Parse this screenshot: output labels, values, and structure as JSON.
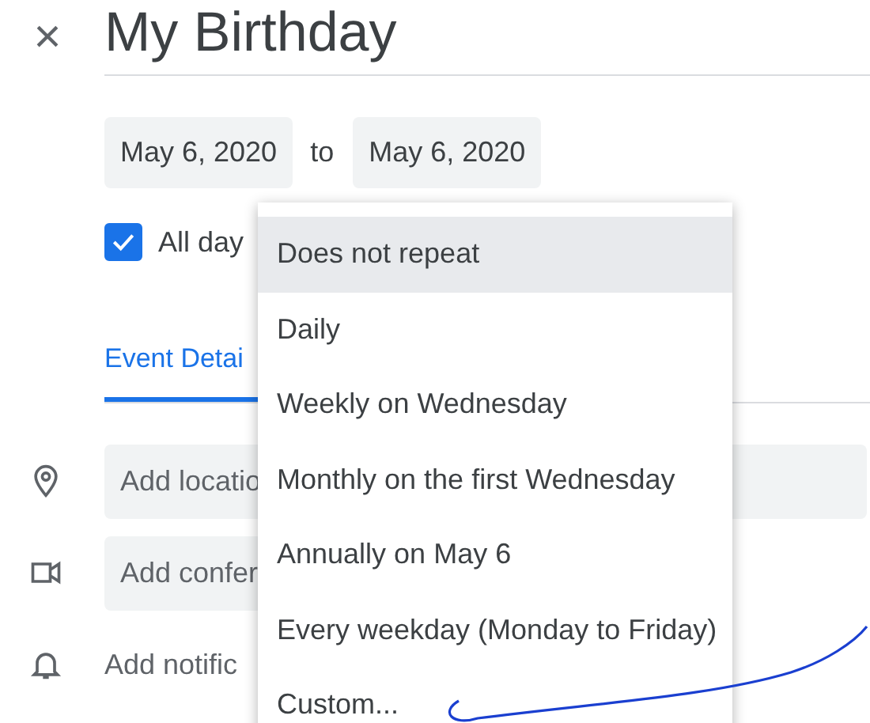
{
  "event": {
    "close": "×",
    "title": "My Birthday",
    "start_date": "May 6, 2020",
    "to": "to",
    "end_date": "May 6, 2020",
    "all_day": {
      "label": "All day",
      "checked": true
    }
  },
  "tabs": [
    {
      "label": "Event Detai",
      "selected": true
    }
  ],
  "fields": [
    {
      "kind": "location",
      "placeholder": "Add locatio"
    },
    {
      "kind": "conference",
      "placeholder": "Add confer"
    },
    {
      "kind": "notification",
      "text": "Add notific"
    }
  ],
  "repeat_menu": [
    {
      "label": "Does not repeat",
      "selected": true
    },
    {
      "label": "Daily",
      "selected": false
    },
    {
      "label": "Weekly on Wednesday",
      "selected": false
    },
    {
      "label": "Monthly on the first Wednesday",
      "selected": false
    },
    {
      "label": "Annually on May 6",
      "selected": false
    },
    {
      "label": "Every weekday (Monday to Friday)",
      "selected": false
    },
    {
      "label": "Custom...",
      "selected": false
    }
  ]
}
